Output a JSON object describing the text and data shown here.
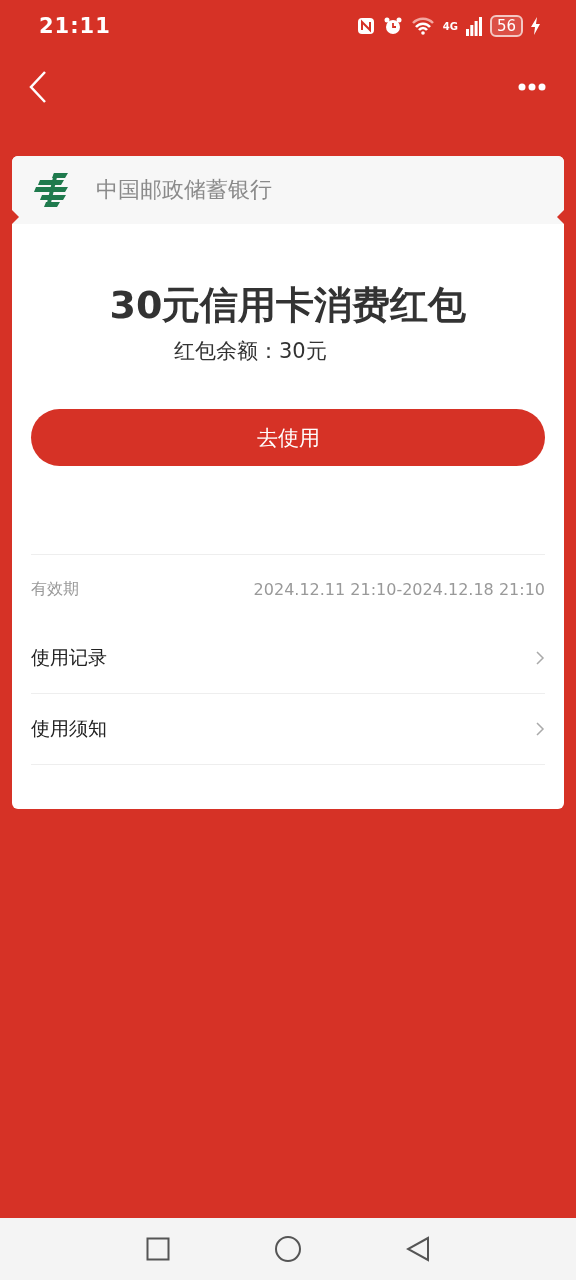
{
  "status_bar": {
    "time": "21:11",
    "network": "4G",
    "battery": "56"
  },
  "card": {
    "bank_name": "中国邮政储蓄银行",
    "title": "30元信用卡消费红包",
    "balance": "红包余额：30元",
    "action": "去使用",
    "validity": {
      "label": "有效期",
      "value": "2024.12.11 21:10-2024.12.18 21:10"
    },
    "links": [
      {
        "label": "使用记录"
      },
      {
        "label": "使用须知"
      }
    ]
  }
}
